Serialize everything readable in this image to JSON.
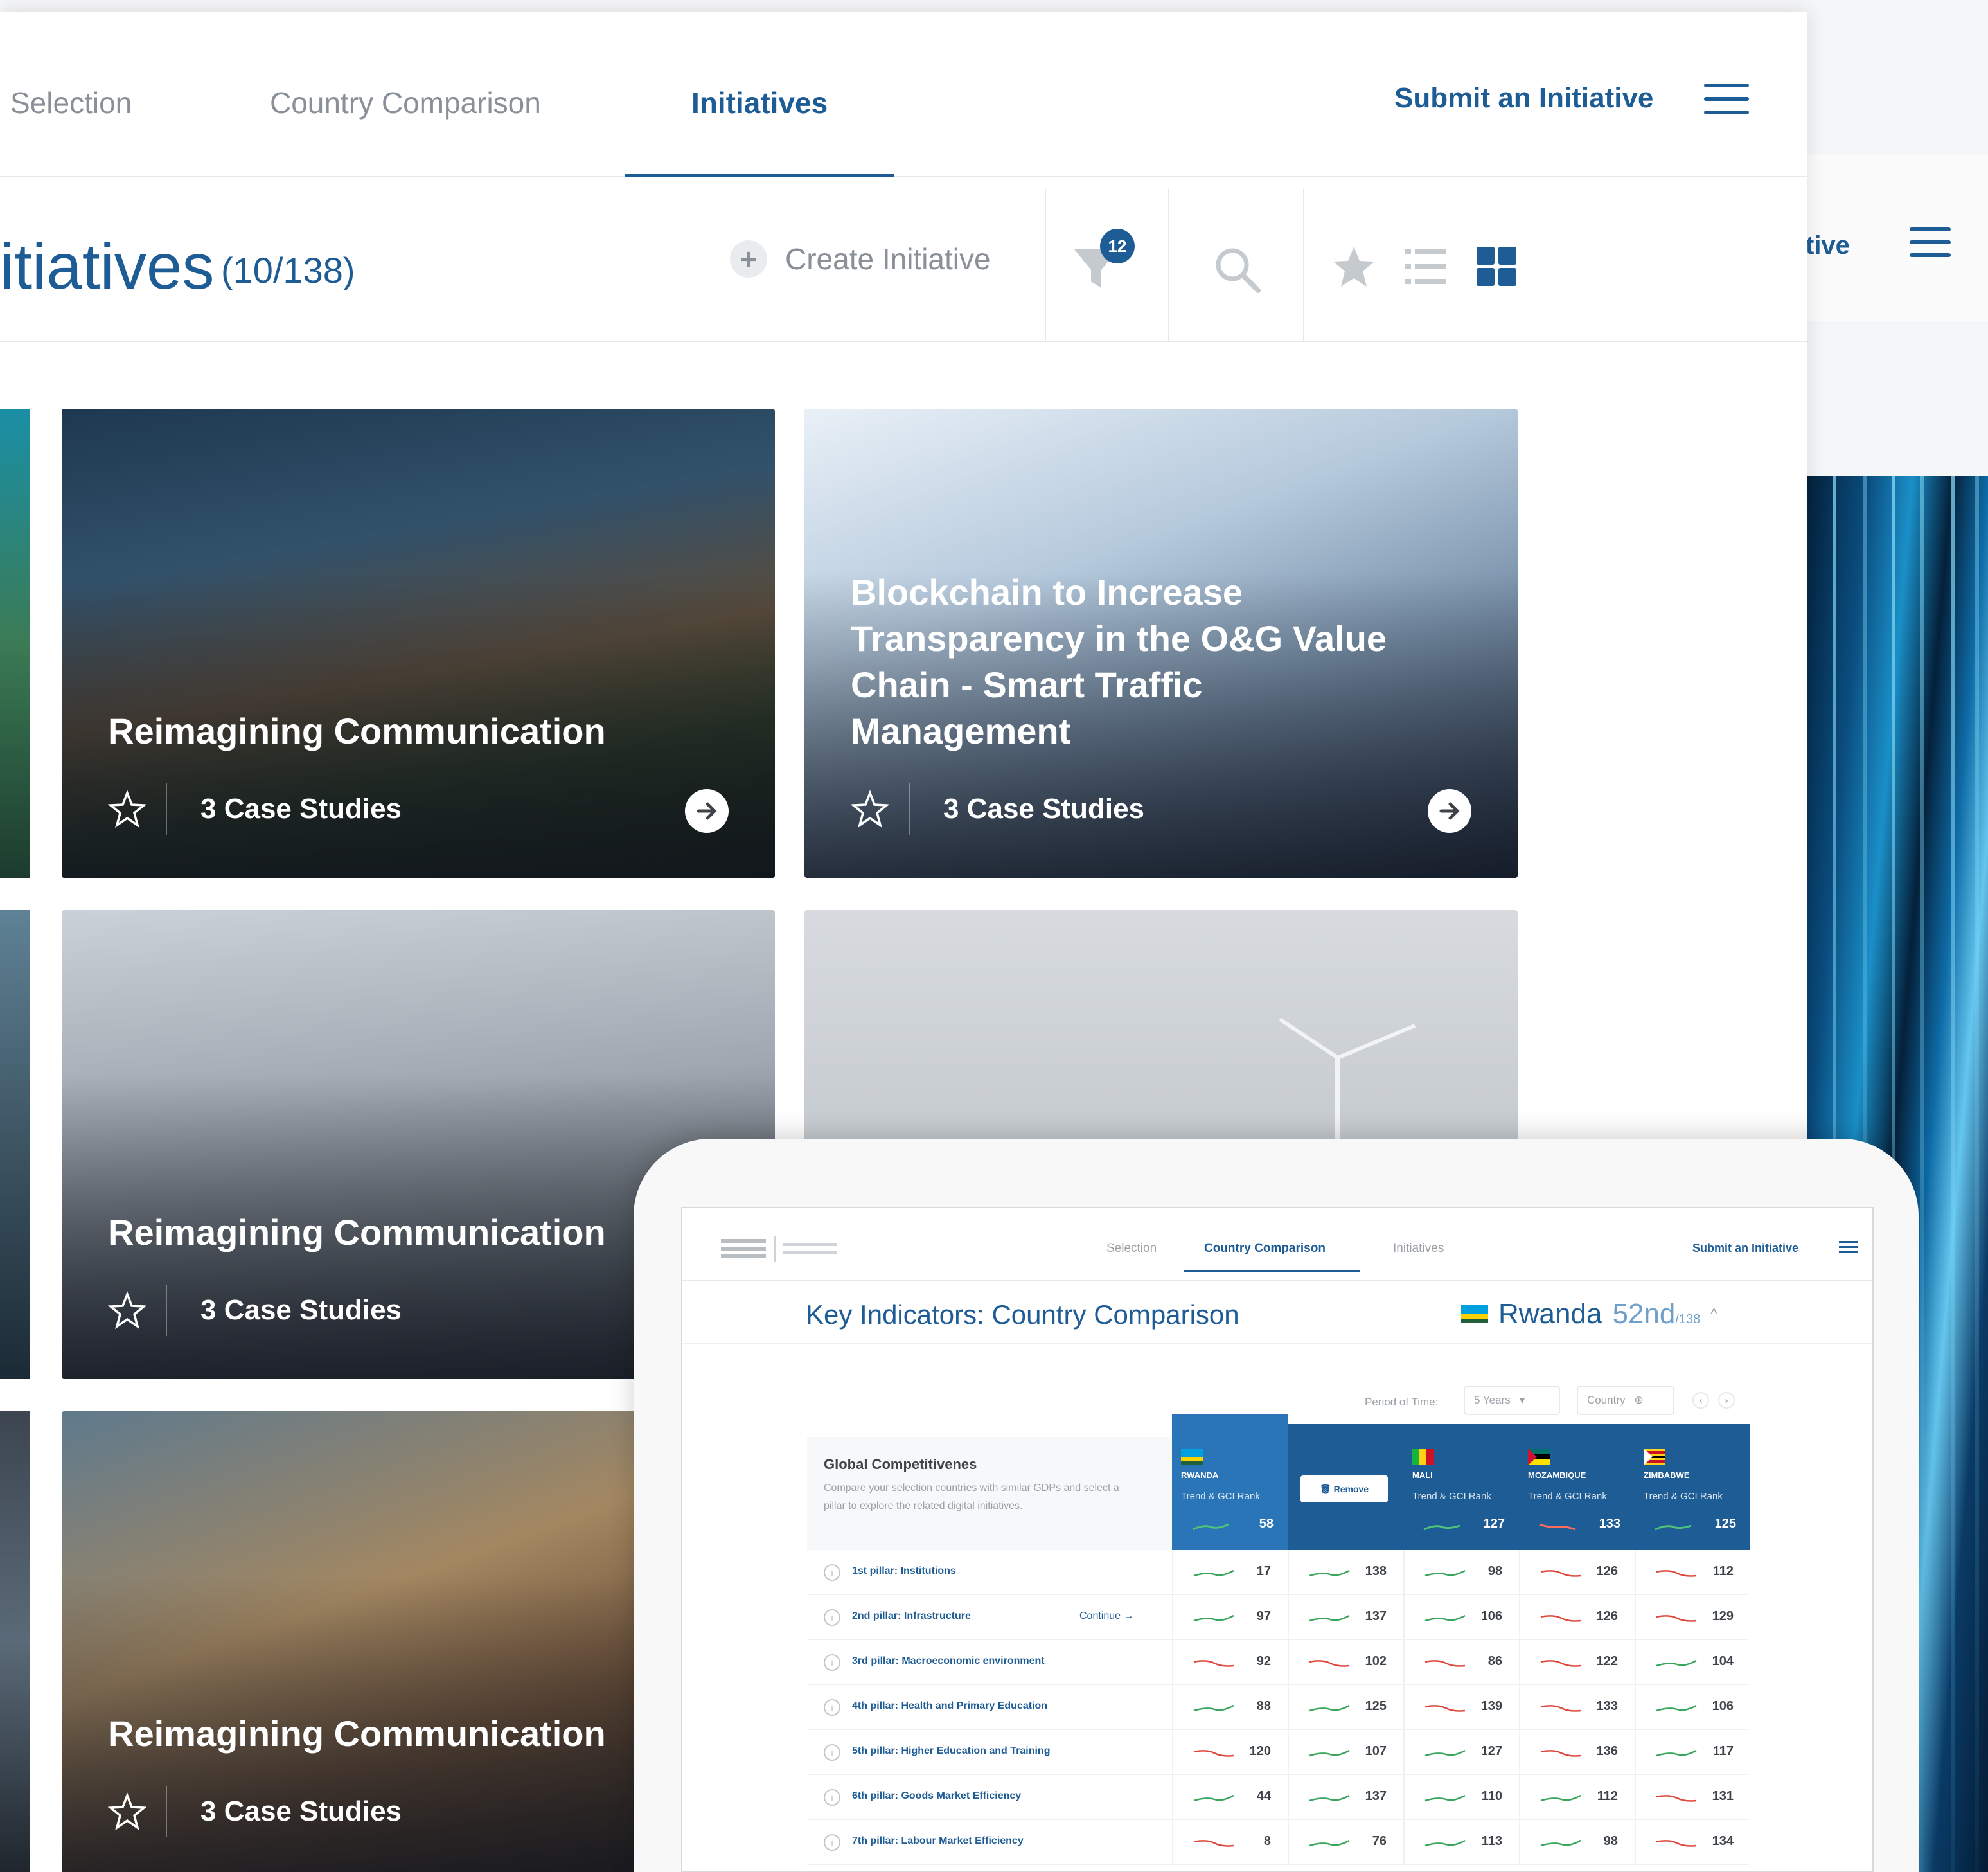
{
  "nav": {
    "tabs": [
      {
        "label": "Selection"
      },
      {
        "label": "Country Comparison"
      },
      {
        "label": "Initiatives"
      }
    ],
    "submit_label": "Submit an Initiative"
  },
  "toolbar": {
    "title": "itiatives",
    "count": "(10/138)",
    "create_label": "Create Initiative",
    "filter_badge": "12"
  },
  "background_window": {
    "label": "tive"
  },
  "cards": [
    {
      "title": "Reimagining Communication",
      "case_studies": "3  Case Studies"
    },
    {
      "title": "Blockchain to Increase Transparency in the O&G Value Chain - Smart Traffic Management",
      "case_studies": "3  Case Studies"
    },
    {
      "title": "Reimagining Communication",
      "case_studies": "3  Case Studies"
    },
    {
      "title": "",
      "case_studies": ""
    },
    {
      "title": "Reimagining Communication",
      "case_studies": "3  Case Studies"
    }
  ],
  "tablet": {
    "nav": {
      "tabs": [
        "Selection",
        "Country Comparison",
        "Initiatives"
      ],
      "submit_label": "Submit an Initiative"
    },
    "title": "Key Indicators: Country Comparison",
    "country": "Rwanda",
    "rank": "52nd",
    "rank_of": "/138",
    "period_label": "Period of Time:",
    "period_value": "5 Years",
    "country_select": "Country",
    "gc_title": "Global Competitivenes",
    "gc_desc": "Compare your selection countries with similar GDPs and select a pillar to explore the related digital initiatives.",
    "remove_label": "Remove",
    "columns": [
      {
        "name": "RWANDA",
        "sub": "Trend & GCI Rank",
        "rank": "58",
        "trend": "up"
      },
      {
        "name": "",
        "sub": "",
        "rank": "",
        "trend": ""
      },
      {
        "name": "MALI",
        "sub": "Trend & GCI Rank",
        "rank": "127",
        "trend": "up"
      },
      {
        "name": "MOZAMBIQUE",
        "sub": "Trend & GCI Rank",
        "rank": "133",
        "trend": "down"
      },
      {
        "name": "ZIMBABWE",
        "sub": "Trend & GCI Rank",
        "rank": "125",
        "trend": "up"
      }
    ],
    "continue_label": "Continue →",
    "rows": [
      {
        "pillar": "1st pillar: Institutions",
        "values": [
          "17",
          "138",
          "98",
          "126",
          "112"
        ],
        "trends": [
          "up",
          "up",
          "up",
          "down",
          "down"
        ]
      },
      {
        "pillar": "2nd pillar: Infrastructure",
        "values": [
          "97",
          "137",
          "106",
          "126",
          "129"
        ],
        "trends": [
          "up",
          "up",
          "up",
          "down",
          "down"
        ]
      },
      {
        "pillar": "3rd pillar: Macroeconomic environment",
        "values": [
          "92",
          "102",
          "86",
          "122",
          "104"
        ],
        "trends": [
          "down",
          "down",
          "down",
          "down",
          "up"
        ]
      },
      {
        "pillar": "4th pillar: Health and Primary Education",
        "values": [
          "88",
          "125",
          "139",
          "133",
          "106"
        ],
        "trends": [
          "up",
          "up",
          "down",
          "down",
          "up"
        ]
      },
      {
        "pillar": "5th pillar: Higher Education and Training",
        "values": [
          "120",
          "107",
          "127",
          "136",
          "117"
        ],
        "trends": [
          "down",
          "up",
          "up",
          "down",
          "up"
        ]
      },
      {
        "pillar": "6th pillar: Goods Market Efficiency",
        "values": [
          "44",
          "137",
          "110",
          "112",
          "131"
        ],
        "trends": [
          "up",
          "up",
          "up",
          "up",
          "down"
        ]
      },
      {
        "pillar": "7th pillar: Labour Market Efficiency",
        "values": [
          "8",
          "76",
          "113",
          "98",
          "134"
        ],
        "trends": [
          "down",
          "up",
          "up",
          "up",
          "down"
        ]
      }
    ]
  },
  "colors": {
    "accent": "#1e5c96",
    "up": "#3aa55c",
    "down": "#e0483c"
  }
}
